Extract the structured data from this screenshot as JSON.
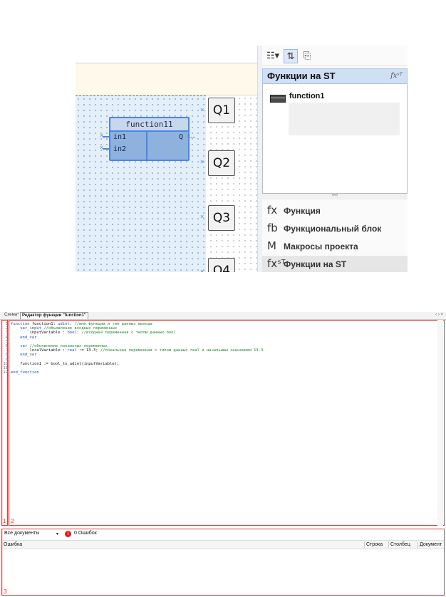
{
  "schema": {
    "block": {
      "title": "function11",
      "inputs": [
        "in1",
        "in2"
      ],
      "output": "Q"
    },
    "outputs": [
      "Q1",
      "Q2",
      "Q3",
      "Q4"
    ]
  },
  "right_panel": {
    "toolbar": {
      "view_icon": "view-options-icon",
      "sort_icon": "sort-icon",
      "folder_icon": "folder-icon"
    },
    "header": {
      "title": "Функции на ST",
      "icon_text": "fxˢᵀ"
    },
    "items": [
      {
        "label": "function1",
        "icon": "function-table-icon"
      }
    ],
    "nav": [
      {
        "icon_text": "fx",
        "label": "Функция"
      },
      {
        "icon_text": "fb",
        "label": "Функциональный блок"
      },
      {
        "icon_text": "M",
        "label": "Макросы проекта"
      },
      {
        "icon_text": "fxˢᵀ",
        "label": "Функции на ST"
      }
    ]
  },
  "editor": {
    "tabs": [
      {
        "label": "Схема*"
      },
      {
        "label": "Редактор функции \"function1\""
      }
    ],
    "tab_nav": "‹ › ×",
    "markers": {
      "one": "1",
      "two": "2",
      "three": "3"
    },
    "line_numbers": [
      "1",
      "2",
      "3",
      "4",
      "5",
      "6",
      "7",
      "8",
      "9",
      "10",
      "11",
      "12"
    ],
    "code": [
      [
        {
          "t": "function ",
          "c": "kw"
        },
        {
          "t": "function1: ",
          "c": ""
        },
        {
          "t": "udint",
          "c": "kw"
        },
        {
          "t": "; //имя функции и тип данных выхода",
          "c": "cm"
        }
      ],
      [
        {
          "t": "    var_input ",
          "c": "kw"
        },
        {
          "t": "//объявление входных переменных",
          "c": "cm"
        }
      ],
      [
        {
          "t": "        inputVariable : ",
          "c": ""
        },
        {
          "t": "bool",
          "c": "kw"
        },
        {
          "t": "; //входная переменная с типом данных bool",
          "c": "cm"
        }
      ],
      [
        {
          "t": "    end_var",
          "c": "kw"
        }
      ],
      [
        {
          "t": "",
          "c": ""
        }
      ],
      [
        {
          "t": "    var ",
          "c": "kw"
        },
        {
          "t": "//объявление локальных переменных",
          "c": "cm"
        }
      ],
      [
        {
          "t": "        localVariable : ",
          "c": ""
        },
        {
          "t": "real",
          "c": "kw"
        },
        {
          "t": " := 13.3; ",
          "c": ""
        },
        {
          "t": "//локальная переменная с типом данных real и начальным значением 13.3",
          "c": "cm"
        }
      ],
      [
        {
          "t": "    end_var",
          "c": "kw"
        }
      ],
      [
        {
          "t": "",
          "c": ""
        }
      ],
      [
        {
          "t": "    function1 := bool_to_udint(inputVariable);",
          "c": ""
        }
      ],
      [
        {
          "t": "",
          "c": ""
        }
      ],
      [
        {
          "t": "end_function",
          "c": "kw"
        }
      ]
    ]
  },
  "errors": {
    "filter": "Все документы",
    "count_label": "0 Ошибок",
    "error_icon_text": "!",
    "dropdown_icon": "▾",
    "columns": [
      "Ошибка",
      "Строка",
      "Столбец",
      "Документ"
    ]
  }
}
